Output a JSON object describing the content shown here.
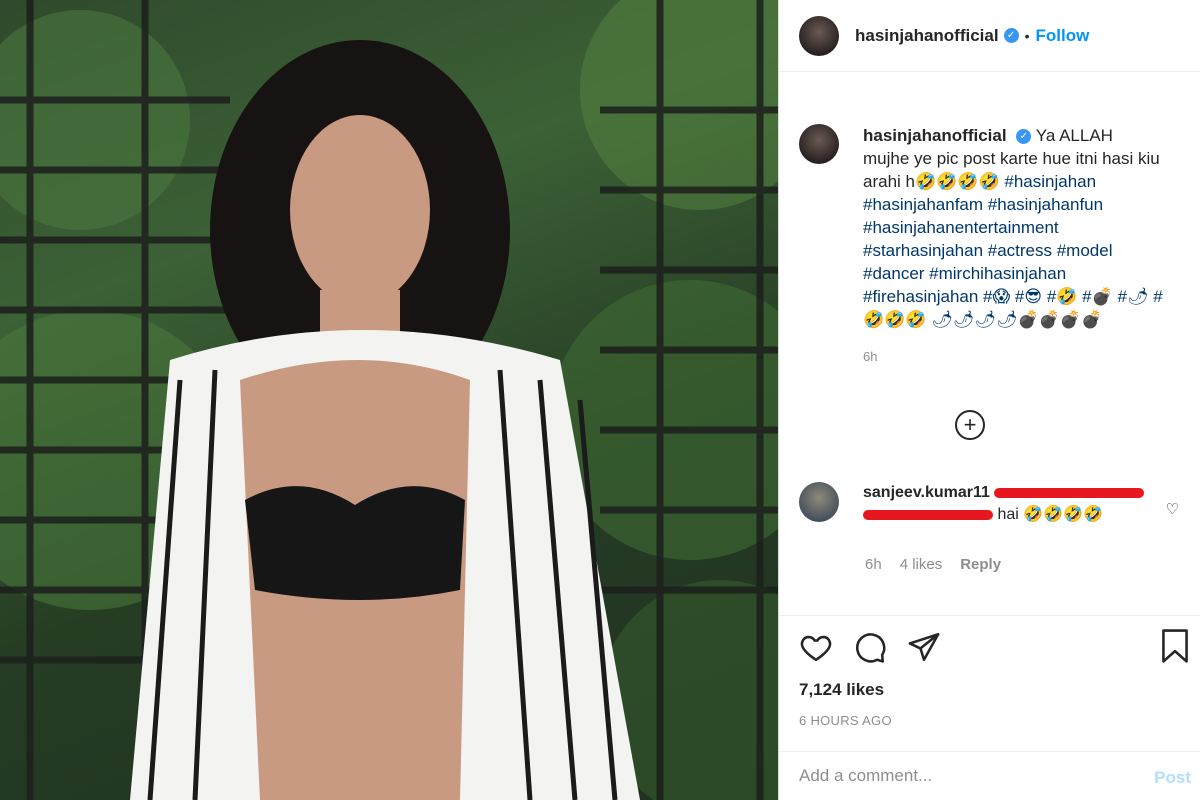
{
  "post": {
    "username": "hasinjahanofficial",
    "follow_label": "Follow",
    "separator": "•",
    "verified_glyph": "✓",
    "photo_alt": "Post photo"
  },
  "caption": {
    "username": "hasinjahanofficial",
    "text_line1": "Ya ALLAH mujhe ye pic post karte hue itni hasi kiu arahi h🤣🤣🤣🤣 ",
    "tags": "#hasinjahan #hasinjahanfam #hasinjahanfun #hasinjahanentertainment #starhasinjahan #actress #model #dancer #mirchihasinjahan #firehasinjahan #😱 #😎 #🤣 #💣 #🌶 #🤣🤣🤣 🌶🌶🌶🌶💣💣💣💣",
    "time": "6h"
  },
  "load_more": {
    "icon": "plus-circle-icon",
    "glyph": "+"
  },
  "comment": {
    "username": "sanjeev.kumar11",
    "text_visible": "hai 🤣🤣🤣🤣",
    "time": "6h",
    "likes": "4 likes",
    "reply": "Reply",
    "heart_glyph": "♡"
  },
  "stats": {
    "likes": "7,124 likes",
    "ago": "6 HOURS AGO"
  },
  "composer": {
    "placeholder": "Add a comment...",
    "post_label": "Post"
  },
  "colors": {
    "link": "#0095f6",
    "hashtag": "#00376b",
    "muted": "#8e8e8e",
    "redaction": "#e8161f"
  }
}
